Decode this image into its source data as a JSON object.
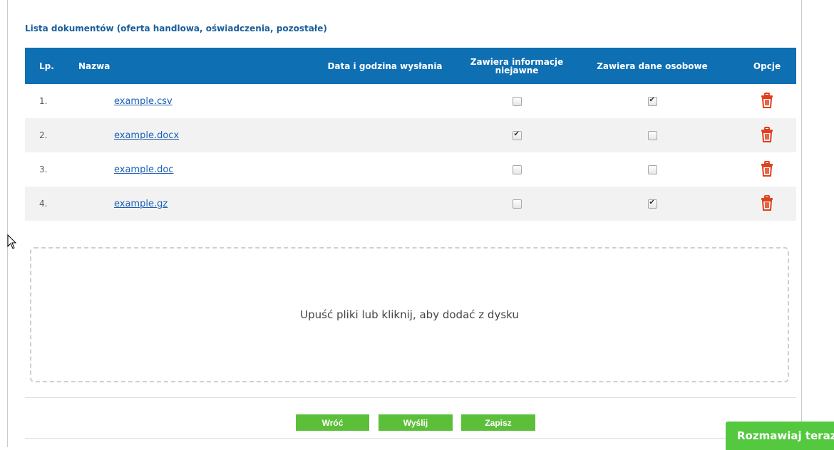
{
  "section_title": "Lista dokumentów (oferta handlowa, oświadczenia, pozostałe)",
  "table": {
    "headers": {
      "lp": "Lp.",
      "name": "Nazwa",
      "date": "Data i godzina wysłania",
      "confidential": "Zawiera informacje niejawne",
      "personal": "Zawiera dane osobowe",
      "options": "Opcje"
    },
    "rows": [
      {
        "lp": "1.",
        "name": "example.csv",
        "date": "",
        "confidential": false,
        "personal": true
      },
      {
        "lp": "2.",
        "name": "example.docx",
        "date": "",
        "confidential": true,
        "personal": false
      },
      {
        "lp": "3.",
        "name": "example.doc",
        "date": "",
        "confidential": false,
        "personal": false
      },
      {
        "lp": "4.",
        "name": "example.gz",
        "date": "",
        "confidential": false,
        "personal": true
      }
    ]
  },
  "dropzone": {
    "text": "Upuść pliki lub kliknij, aby dodać z dysku"
  },
  "buttons": {
    "back": "Wróć",
    "send": "Wyślij",
    "save": "Zapisz"
  },
  "chat": {
    "label": "Rozmawiaj teraz"
  },
  "icons": {
    "delete": "trash-icon",
    "cursor": "mouse-pointer-icon"
  },
  "colors": {
    "header_bg": "#0e6fb3",
    "accent_green": "#5cbf3a",
    "delete_red": "#e2401c",
    "link": "#1a5fb4"
  }
}
